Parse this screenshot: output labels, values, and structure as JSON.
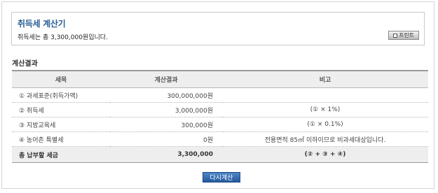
{
  "summary": {
    "title": "취득세 계산기",
    "text": "취득세는 총 3,300,000원입니다.",
    "print_label": "프린트"
  },
  "section_title": "계산결과",
  "table": {
    "headers": [
      "세목",
      "계산결과",
      "비고"
    ],
    "rows": [
      {
        "item": "① 과세표준(취득가액)",
        "result": "300,000,000원",
        "note": ""
      },
      {
        "item": "② 취득세",
        "result": "3,000,000원",
        "note": "(① × 1%)"
      },
      {
        "item": "③ 지방교육세",
        "result": "300,000원",
        "note": "(① × 0.1%)"
      },
      {
        "item": "④ 농어촌 특별세",
        "result": "0원",
        "note": "전용면적 85㎡ 이하이므로 비과세대상입니다."
      }
    ],
    "total": {
      "item": "총 납부할 세금",
      "result": "3,300,000",
      "note": "(② + ③ + ④)"
    }
  },
  "recalc_label": "다시계산"
}
